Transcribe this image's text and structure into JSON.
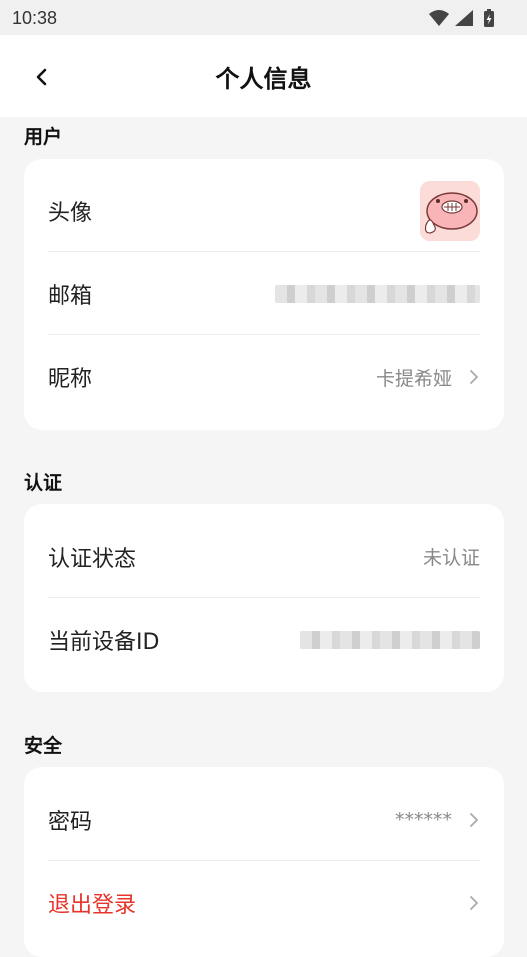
{
  "status_bar": {
    "time": "10:38"
  },
  "header": {
    "title": "个人信息"
  },
  "sections": {
    "user": {
      "title": "用户",
      "avatar_label": "头像",
      "email_label": "邮箱",
      "nickname_label": "昵称",
      "nickname_value": "卡提希娅"
    },
    "auth": {
      "title": "认证",
      "status_label": "认证状态",
      "status_value": "未认证",
      "device_label": "当前设备ID"
    },
    "security": {
      "title": "安全",
      "password_label": "密码",
      "password_value": "******",
      "logout_label": "退出登录"
    }
  },
  "colors": {
    "danger": "#e8342b",
    "muted": "#888888",
    "page_bg": "#f5f5f5"
  }
}
